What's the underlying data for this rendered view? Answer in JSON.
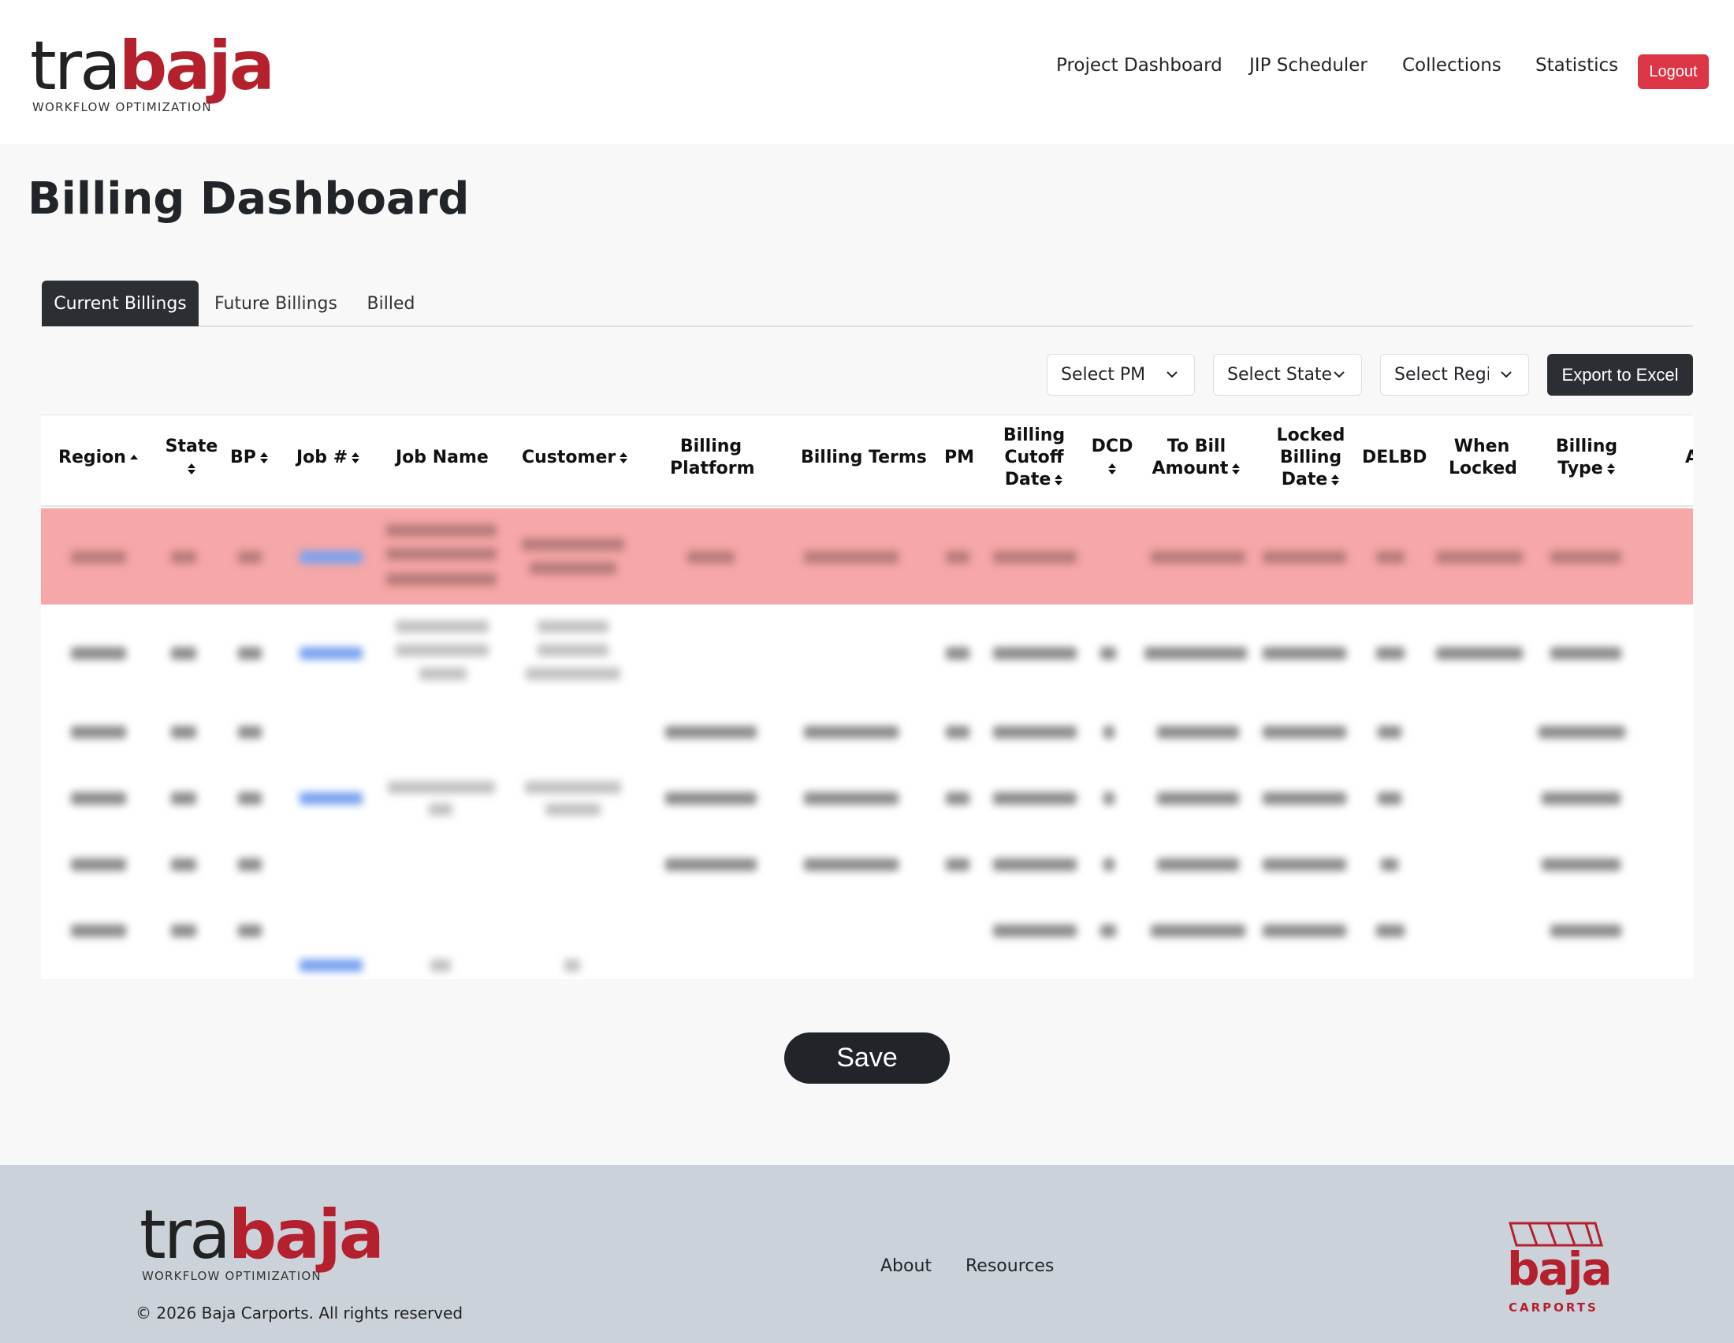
{
  "brand": {
    "logo_left": "tra",
    "logo_right": "baja",
    "tagline": "WORKFLOW OPTIMIZATION"
  },
  "nav": {
    "project_dashboard": "Project Dashboard",
    "jip_scheduler": "JIP Scheduler",
    "collections": "Collections",
    "statistics": "Statistics",
    "logout": "Logout"
  },
  "page": {
    "title": "Billing Dashboard"
  },
  "tabs": [
    {
      "label": "Current Billings",
      "active": true
    },
    {
      "label": "Future Billings",
      "active": false
    },
    {
      "label": "Billed",
      "active": false
    }
  ],
  "filters": {
    "pm": "Select PM",
    "state": "Select State",
    "region": "Select Region",
    "export": "Export to Excel"
  },
  "table": {
    "columns": [
      {
        "label": "Region",
        "sort": "asc"
      },
      {
        "label": "State",
        "sort": "both"
      },
      {
        "label": "BP",
        "sort": "both"
      },
      {
        "label": "Job #",
        "sort": "both"
      },
      {
        "label": "Job Name",
        "sort": "none"
      },
      {
        "label": "Customer",
        "sort": "both"
      },
      {
        "label_line1": "Billing",
        "label_line2": "Platform",
        "sort": "none"
      },
      {
        "label": "Billing Terms",
        "sort": "none"
      },
      {
        "label": "PM",
        "sort": "none"
      },
      {
        "label_line1": "Billing",
        "label_line2": "Cutoff",
        "label_line3": "Date",
        "sort": "both"
      },
      {
        "label": "DCD",
        "sort": "both"
      },
      {
        "label_line1": "To Bill",
        "label_line2": "Amount",
        "sort": "both"
      },
      {
        "label_line1": "Locked",
        "label_line2": "Billing",
        "label_line3": "Date",
        "sort": "both"
      },
      {
        "label": "DELBD",
        "sort": "none"
      },
      {
        "label_line1": "When",
        "label_line2": "Locked",
        "sort": "none"
      },
      {
        "label_line1": "Billing",
        "label_line2": "Type",
        "sort": "both"
      },
      {
        "label": "A",
        "sort": "none"
      }
    ],
    "highlight_color": "#f6a7a7"
  },
  "actions": {
    "save": "Save"
  },
  "footer": {
    "copyright": "© 2026 Baja Carports. All rights reserved",
    "about": "About",
    "resources": "Resources",
    "brand_word": "baja",
    "brand_sub": "CARPORTS"
  },
  "colors": {
    "brand_red": "#b5202e",
    "logout_red": "#dc3545",
    "dark": "#212529"
  }
}
